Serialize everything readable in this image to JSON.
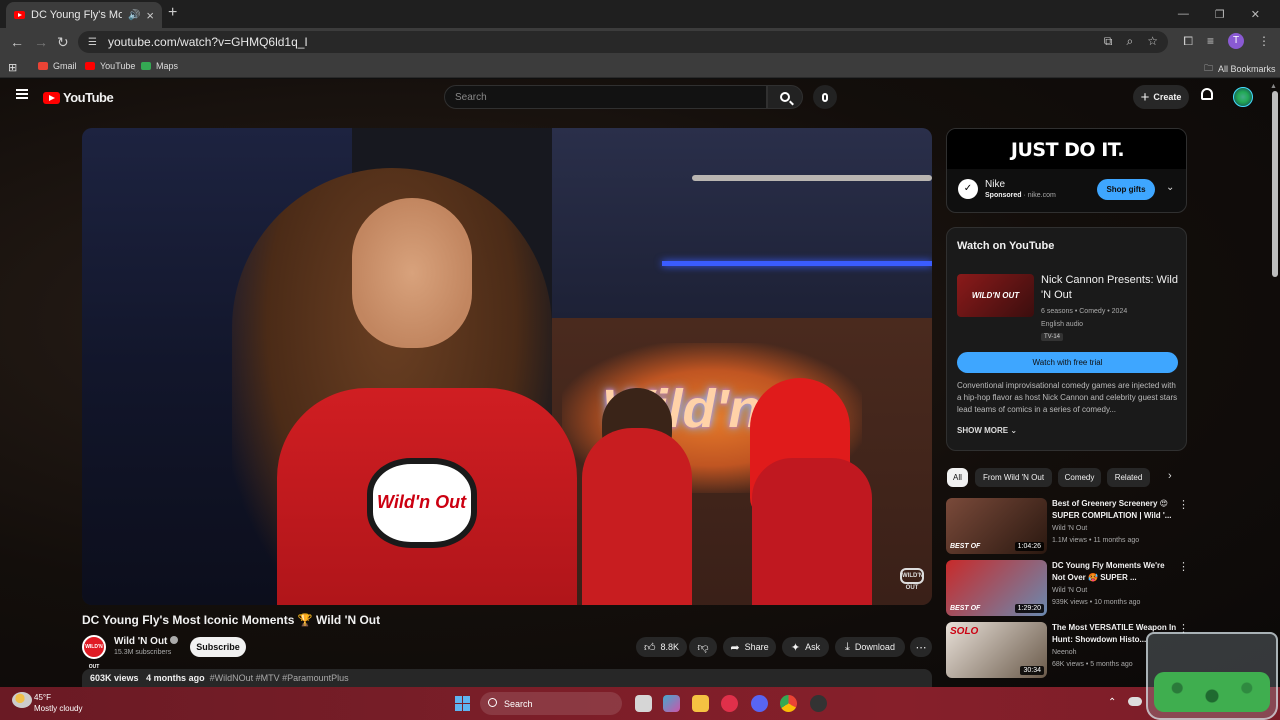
{
  "browser": {
    "tab_title": "DC Young Fly's Most Iconic",
    "new_tab": "+",
    "url": "youtube.com/watch?v=GHMQ6ld1q_I",
    "profile_initial": "T",
    "bookmarks": [
      {
        "label": "Gmail",
        "color": "#ea4335"
      },
      {
        "label": "YouTube",
        "color": "#ff0000"
      },
      {
        "label": "Maps",
        "color": "#34a853"
      }
    ],
    "all_bookmarks": "All Bookmarks"
  },
  "youtube": {
    "logo_text": "YouTube",
    "search_placeholder": "Search",
    "create_label": "Create"
  },
  "video": {
    "title": "DC Young Fly's Most Iconic Moments 🏆 Wild 'N Out",
    "watermark": "WILD'N OUT",
    "neon_sign": "Wild'n",
    "channel": {
      "name": "Wild 'N Out",
      "subscribers": "15.3M subscribers",
      "avatar_text": "WILD'N OUT"
    },
    "subscribe_label": "Subscribe",
    "likes": "8.8K",
    "share_label": "Share",
    "ask_label": "Ask",
    "download_label": "Download",
    "views": "603K views",
    "date": "4 months ago",
    "hashtags": "#WildNOut #MTV #ParamountPlus"
  },
  "ad": {
    "banner": "JUST DO IT.",
    "brand": "Nike",
    "sponsored": "Sponsored",
    "domain": "· nike.com",
    "cta": "Shop gifts"
  },
  "watch_on_youtube": {
    "heading": "Watch on YouTube",
    "show_title": "Nick Cannon Presents: Wild 'N Out",
    "meta": "6 seasons • Comedy • 2024",
    "audio": "English audio",
    "rating": "TV-14",
    "cta": "Watch with free trial",
    "description": "Conventional improvisational comedy games are injected with a hip-hop flavor as host Nick Cannon and celebrity guest stars lead teams of comics in a series of comedy...",
    "show_more": "SHOW MORE"
  },
  "chips": [
    "All",
    "From Wild 'N Out",
    "Comedy",
    "Related"
  ],
  "recommendations": [
    {
      "title": "Best of Greenery Screenery 😍 SUPER COMPILATION | Wild '...",
      "channel": "Wild 'N Out",
      "stats": "1.1M views • 11 months ago",
      "duration": "1:04:26",
      "label": "BEST OF"
    },
    {
      "title": "DC Young Fly Moments We're Not Over 🥵 SUPER ...",
      "channel": "Wild 'N Out",
      "stats": "939K views • 10 months ago",
      "duration": "1:29:20",
      "label": "BEST OF"
    },
    {
      "title": "The Most VERSATILE Weapon In Hunt: Showdown Histo...",
      "channel": "Neenoh",
      "stats": "68K views • 5 months ago",
      "duration": "30:34",
      "label": "SOLO"
    }
  ],
  "taskbar": {
    "temp": "45°F",
    "condition": "Mostly cloudy",
    "search_label": "Search"
  }
}
